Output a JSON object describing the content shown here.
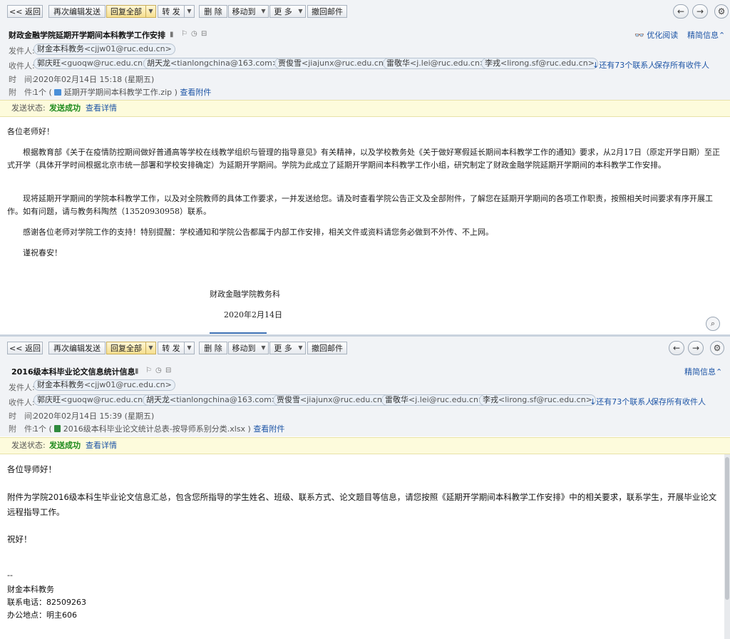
{
  "toolbar": {
    "back": "<< 返回",
    "reedit": "再次编辑发送",
    "reply_all": "回复全部",
    "forward": "转 发",
    "delete": "删 除",
    "move_to": "移动到",
    "more": "更 多",
    "recall": "撤回邮件"
  },
  "labels": {
    "sender": "发件人:",
    "recipients": "收件人:",
    "time": "时　间:",
    "attachment": "附　件:",
    "send_status": "发送状态:",
    "send_ok": "发送成功",
    "view_detail": "查看详情",
    "more_contacts": "↓还有73个联系人",
    "save_all": "保存所有收件人",
    "view_attach": "查看附件",
    "optimized_read": "优化阅读",
    "brief_info": "精简信息"
  },
  "sender": {
    "name": "财金本科教务",
    "addr": "<cjjw01@ruc.edu.cn>"
  },
  "recipients": [
    {
      "name": "郭庆旺",
      "addr": "<guoqw@ruc.edu.cn>"
    },
    {
      "name": "胡天龙",
      "addr": "<tianlongchina@163.com>"
    },
    {
      "name": "贾俊雪",
      "addr": "<jiajunx@ruc.edu.cn>"
    },
    {
      "name": "雷敬华",
      "addr": "<j.lei@ruc.edu.cn>"
    },
    {
      "name": "李戎",
      "addr": "<lirong.sf@ruc.edu.cn>"
    }
  ],
  "mail1": {
    "subject": "财政金融学院延期开学期间本科教学工作安排",
    "time": "2020年02月14日 15:18 (星期五)",
    "attach_count": "1个 (",
    "attach_name": "延期开学期间本科教学工作.zip )",
    "body": {
      "greeting": "各位老师好！",
      "p1": "根据教育部《关于在疫情防控期间做好普通高等学校在线教学组织与管理的指导意见》有关精神，以及学校教务处《关于做好寒假延长期间本科教学工作的通知》要求，从2月17日（原定开学日期）至正式开学（具体开学时间根据北京市统一部署和学校安排确定）为延期开学期间。学院为此成立了延期开学期间本科教学工作小组，研究制定了财政金融学院延期开学期间的本科教学工作安排。",
      "p2": "现将延期开学期间的学院本科教学工作，以及对全院教师的具体工作要求，一并发送给您。请及时查看学院公告正文及全部附件，了解您在延期开学期间的各项工作职责，按照相关时间要求有序开展工作。如有问题，请与教务科陶然（13520930958）联系。",
      "p3": "感谢各位老师对学院工作的支持！特别提醒：学校通知和学院公告都属于内部工作安排，相关文件或资料请您务必做到不外传、不上网。",
      "p4": "谨祝春安！",
      "sign": "财政金融学院教务科",
      "date": "2020年2月14日"
    }
  },
  "mail2": {
    "subject": "2016级本科毕业论文信息统计信息",
    "time": "2020年02月14日 15:39 (星期五)",
    "attach_count": "1个 (",
    "attach_name": "2016级本科毕业论文统计总表-按导师系别分类.xlsx )",
    "body": {
      "greeting": "各位导师好！",
      "p1": "附件为学院2016级本科生毕业论文信息汇总，包含您所指导的学生姓名、班级、联系方式、论文题目等信息，请您按照《延期开学期间本科教学工作安排》中的相关要求，联系学生，开展毕业论文远程指导工作。",
      "p2": "祝好！",
      "sep": "--",
      "sig_name": "财金本科教务",
      "sig_phone": "联系电话：82509263",
      "sig_office": "办公地点：明主606"
    }
  },
  "icons": [
    "back-arrow-icon",
    "forward-arrow-icon",
    "gear-icon",
    "flag-icon",
    "clock-icon",
    "zoom-icon",
    "zip-file-icon",
    "excel-file-icon"
  ],
  "colors": {
    "link": "#1f56a6",
    "success": "#1c8a1c",
    "status_bg": "#fdfbdc",
    "header_bg": "#f1f3f6"
  }
}
